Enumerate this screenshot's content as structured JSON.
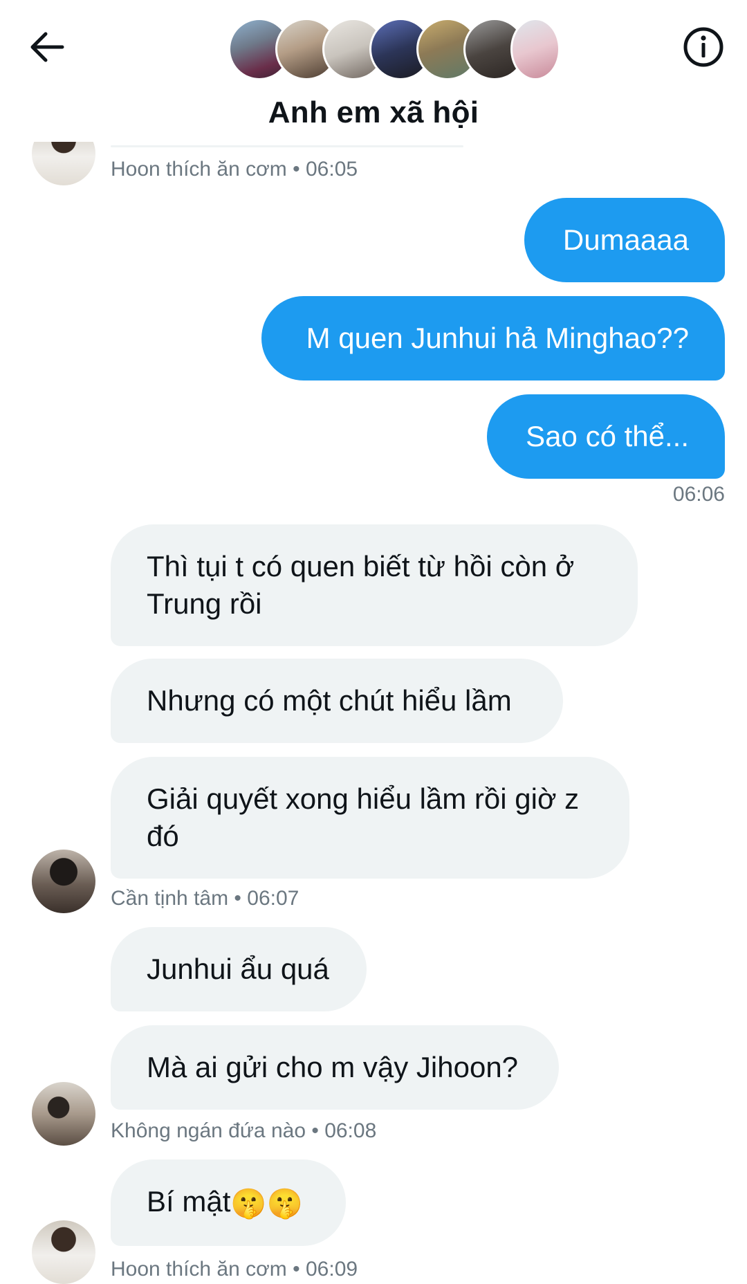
{
  "header": {
    "title": "Anh em xã hội",
    "back_icon": "arrow-left-icon",
    "info_icon": "info-circle-icon",
    "member_avatars": 7
  },
  "messages": [
    {
      "sender": "Hoon thích ăn cơm",
      "time": "06:05"
    },
    {
      "direction": "out",
      "text": "Dumaaaa"
    },
    {
      "direction": "out",
      "text": "M quen Junhui hả Minghao??"
    },
    {
      "direction": "out",
      "text": "Sao có thể..."
    },
    {
      "time_out": "06:06"
    },
    {
      "direction": "in",
      "text": "Thì tụi t có quen biết từ hồi còn ở Trung rồi"
    },
    {
      "direction": "in",
      "text": "Nhưng có một chút hiểu lầm"
    },
    {
      "direction": "in",
      "text": "Giải quyết xong hiểu lầm rồi giờ z đó"
    },
    {
      "sender": "Cần tịnh tâm",
      "time": "06:07"
    },
    {
      "direction": "in",
      "text": "Junhui ẩu quá"
    },
    {
      "direction": "in",
      "text": "Mà ai gửi cho m vậy Jihoon?"
    },
    {
      "sender": "Không ngán đứa nào",
      "time": "06:08"
    },
    {
      "direction": "in",
      "text": "Bí mật",
      "emoji": "🤫🤫"
    },
    {
      "sender": "Hoon thích ăn cơm",
      "time": "06:09"
    }
  ],
  "colors": {
    "outgoing_bubble": "#1d9bf0",
    "incoming_bubble": "#eff3f4",
    "meta_text": "#6b7780"
  }
}
